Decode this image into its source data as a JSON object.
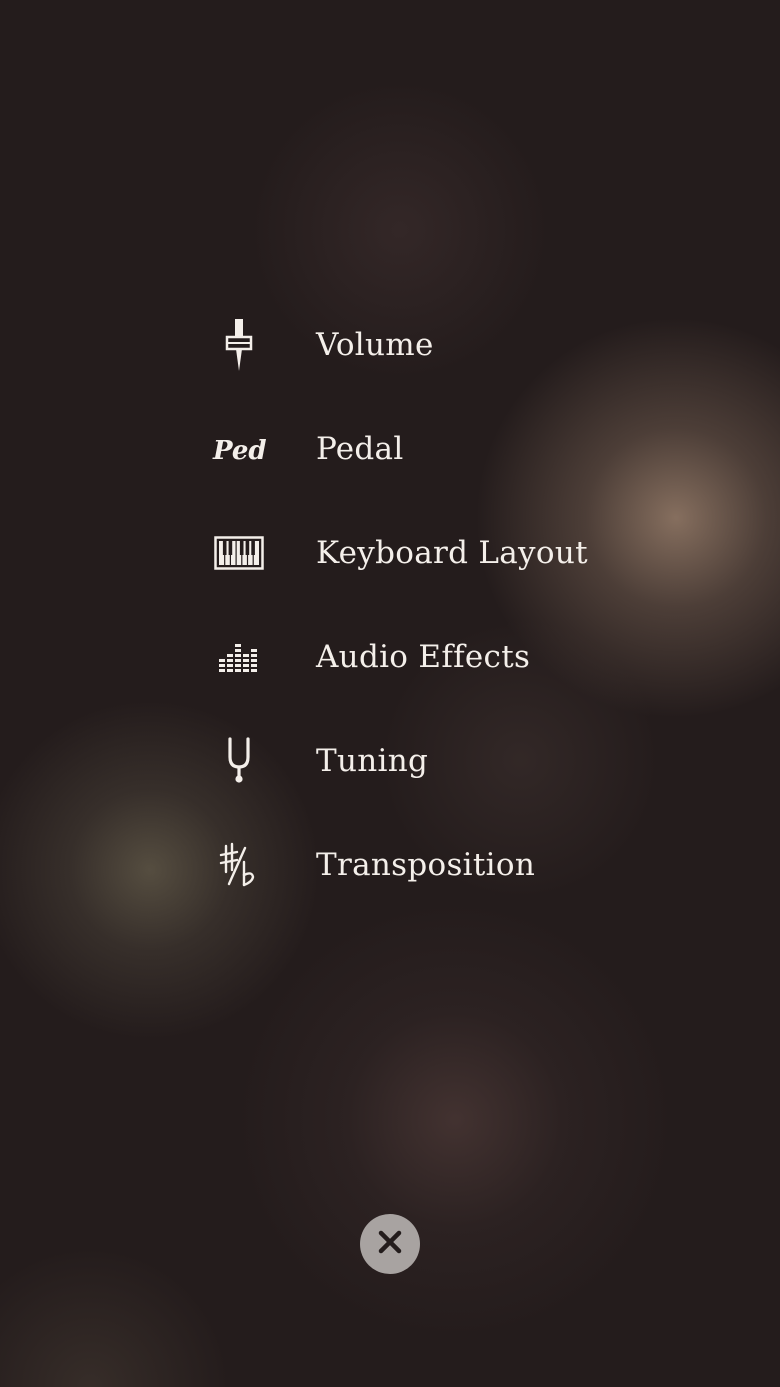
{
  "menu": {
    "items": [
      {
        "id": "volume",
        "label": "Volume",
        "icon": "volume-fader-icon"
      },
      {
        "id": "pedal",
        "label": "Pedal",
        "icon": "pedal-ped-icon"
      },
      {
        "id": "keyboard-layout",
        "label": "Keyboard Layout",
        "icon": "piano-keyboard-icon"
      },
      {
        "id": "audio-effects",
        "label": "Audio Effects",
        "icon": "equalizer-icon"
      },
      {
        "id": "tuning",
        "label": "Tuning",
        "icon": "tuning-fork-icon"
      },
      {
        "id": "transposition",
        "label": "Transposition",
        "icon": "sharp-flat-icon"
      }
    ]
  },
  "close": {
    "icon": "close-icon"
  },
  "colors": {
    "text": "#f4efea",
    "background": "#241c1c",
    "close_button": "#a8a3a1",
    "close_glyph": "#231c1c"
  }
}
